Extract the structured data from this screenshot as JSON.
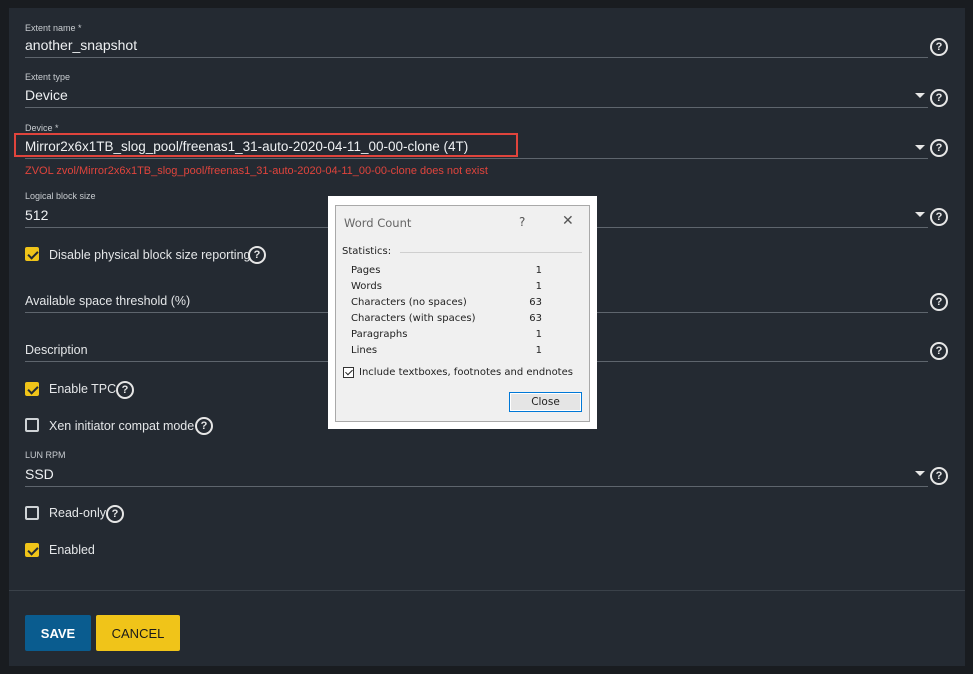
{
  "form": {
    "extent_name": {
      "label": "Extent name *",
      "value": "another_snapshot"
    },
    "extent_type": {
      "label": "Extent type",
      "value": "Device"
    },
    "device": {
      "label": "Device *",
      "value": "Mirror2x6x1TB_slog_pool/freenas1_31-auto-2020-04-11_00-00-clone (4T)",
      "error": "ZVOL zvol/Mirror2x6x1TB_slog_pool/freenas1_31-auto-2020-04-11_00-00-clone does not exist"
    },
    "logical_block_size": {
      "label": "Logical block size",
      "value": "512"
    },
    "disable_physical_block": {
      "label": "Disable physical block size reporting",
      "checked": true
    },
    "available_space_threshold": {
      "label": "Available space threshold (%)"
    },
    "description": {
      "label": "Description"
    },
    "enable_tpc": {
      "label": "Enable TPC",
      "checked": true
    },
    "xen_compat": {
      "label": "Xen initiator compat mode",
      "checked": false
    },
    "lun_rpm": {
      "label": "LUN RPM",
      "value": "SSD"
    },
    "read_only": {
      "label": "Read-only",
      "checked": false
    },
    "enabled": {
      "label": "Enabled",
      "checked": true
    }
  },
  "buttons": {
    "save": "SAVE",
    "cancel": "CANCEL"
  },
  "help_glyph": "?",
  "dialog": {
    "title": "Word Count",
    "help_glyph": "?",
    "close_glyph": "✕",
    "statistics_label": "Statistics:",
    "rows": [
      {
        "label": "Pages",
        "value": "1"
      },
      {
        "label": "Words",
        "value": "1"
      },
      {
        "label": "Characters (no spaces)",
        "value": "63"
      },
      {
        "label": "Characters (with spaces)",
        "value": "63"
      },
      {
        "label": "Paragraphs",
        "value": "1"
      },
      {
        "label": "Lines",
        "value": "1"
      }
    ],
    "include_label": "Include textboxes, footnotes and endnotes",
    "include_checked": true,
    "close_button": "Close"
  },
  "colors": {
    "background": "#242a32",
    "accent_yellow": "#f0c419",
    "save_blue": "#0a5c8f",
    "error_red": "#e0443c"
  }
}
